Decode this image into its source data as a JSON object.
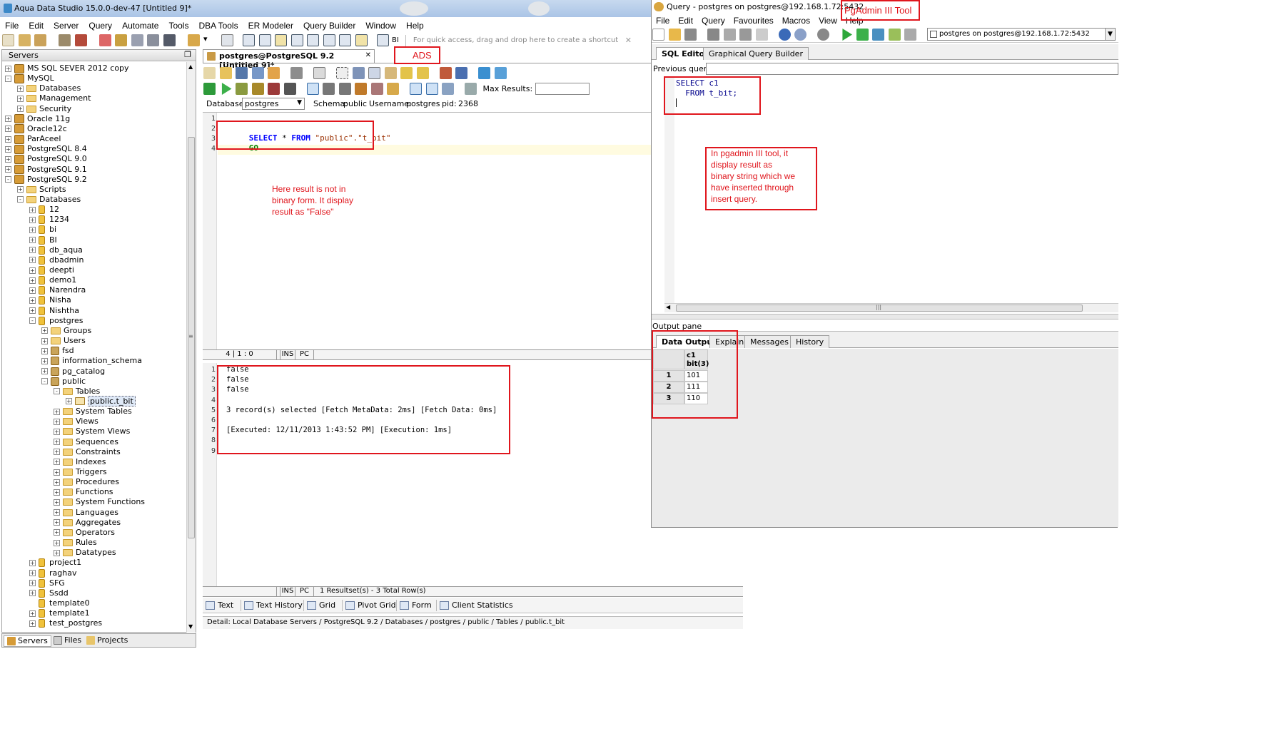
{
  "ads": {
    "title": "Aqua Data Studio 15.0.0-dev-47 [Untitled 9]*",
    "menu": [
      "File",
      "Edit",
      "Server",
      "Query",
      "Automate",
      "Tools",
      "DBA Tools",
      "ER Modeler",
      "Query Builder",
      "Window",
      "Help"
    ],
    "toolbar_hint": "For quick access, drag and drop here to create a shortcut",
    "toolbar_bi": "BI",
    "servers_title": "Servers",
    "tree": [
      {
        "d": 1,
        "e": "+",
        "i": "server",
        "t": "MS SQL SEVER 2012 copy"
      },
      {
        "d": 1,
        "e": "-",
        "i": "server",
        "t": "MySQL"
      },
      {
        "d": 2,
        "e": "+",
        "i": "folder",
        "t": "Databases"
      },
      {
        "d": 2,
        "e": "+",
        "i": "folder",
        "t": "Management"
      },
      {
        "d": 2,
        "e": "+",
        "i": "folder",
        "t": "Security"
      },
      {
        "d": 1,
        "e": "+",
        "i": "server",
        "t": "Oracle 11g"
      },
      {
        "d": 1,
        "e": "+",
        "i": "server",
        "t": "Oracle12c"
      },
      {
        "d": 1,
        "e": "+",
        "i": "server",
        "t": "ParAceel"
      },
      {
        "d": 1,
        "e": "+",
        "i": "server",
        "t": "PostgreSQL 8.4"
      },
      {
        "d": 1,
        "e": "+",
        "i": "server",
        "t": "PostgreSQL 9.0"
      },
      {
        "d": 1,
        "e": "+",
        "i": "server",
        "t": "PostgreSQL 9.1"
      },
      {
        "d": 1,
        "e": "-",
        "i": "server",
        "t": "PostgreSQL 9.2"
      },
      {
        "d": 2,
        "e": "+",
        "i": "folder",
        "t": "Scripts"
      },
      {
        "d": 2,
        "e": "-",
        "i": "folder",
        "t": "Databases"
      },
      {
        "d": 3,
        "e": "+",
        "i": "db",
        "t": "12"
      },
      {
        "d": 3,
        "e": "+",
        "i": "db",
        "t": "1234"
      },
      {
        "d": 3,
        "e": "+",
        "i": "db",
        "t": "bi"
      },
      {
        "d": 3,
        "e": "+",
        "i": "db",
        "t": "BI"
      },
      {
        "d": 3,
        "e": "+",
        "i": "db",
        "t": "db_aqua"
      },
      {
        "d": 3,
        "e": "+",
        "i": "db",
        "t": "dbadmin"
      },
      {
        "d": 3,
        "e": "+",
        "i": "db",
        "t": "deepti"
      },
      {
        "d": 3,
        "e": "+",
        "i": "db",
        "t": "demo1"
      },
      {
        "d": 3,
        "e": "+",
        "i": "db",
        "t": "Narendra"
      },
      {
        "d": 3,
        "e": "+",
        "i": "db",
        "t": "Nisha"
      },
      {
        "d": 3,
        "e": "+",
        "i": "db",
        "t": "Nishtha"
      },
      {
        "d": 3,
        "e": "-",
        "i": "db",
        "t": "postgres"
      },
      {
        "d": 4,
        "e": "+",
        "i": "folder",
        "t": "Groups"
      },
      {
        "d": 4,
        "e": "+",
        "i": "folder",
        "t": "Users"
      },
      {
        "d": 4,
        "e": "+",
        "i": "schema",
        "t": "fsd"
      },
      {
        "d": 4,
        "e": "+",
        "i": "schema",
        "t": "information_schema"
      },
      {
        "d": 4,
        "e": "+",
        "i": "schema",
        "t": "pg_catalog"
      },
      {
        "d": 4,
        "e": "-",
        "i": "schema",
        "t": "public"
      },
      {
        "d": 5,
        "e": "-",
        "i": "folder",
        "t": "Tables"
      },
      {
        "d": 6,
        "e": "+",
        "i": "table",
        "t": "public.t_bit",
        "sel": true
      },
      {
        "d": 5,
        "e": "+",
        "i": "folder",
        "t": "System Tables"
      },
      {
        "d": 5,
        "e": "+",
        "i": "folder",
        "t": "Views"
      },
      {
        "d": 5,
        "e": "+",
        "i": "folder",
        "t": "System Views"
      },
      {
        "d": 5,
        "e": "+",
        "i": "folder",
        "t": "Sequences"
      },
      {
        "d": 5,
        "e": "+",
        "i": "folder",
        "t": "Constraints"
      },
      {
        "d": 5,
        "e": "+",
        "i": "folder",
        "t": "Indexes"
      },
      {
        "d": 5,
        "e": "+",
        "i": "folder",
        "t": "Triggers"
      },
      {
        "d": 5,
        "e": "+",
        "i": "folder",
        "t": "Procedures"
      },
      {
        "d": 5,
        "e": "+",
        "i": "folder",
        "t": "Functions"
      },
      {
        "d": 5,
        "e": "+",
        "i": "folder",
        "t": "System Functions"
      },
      {
        "d": 5,
        "e": "+",
        "i": "folder",
        "t": "Languages"
      },
      {
        "d": 5,
        "e": "+",
        "i": "folder",
        "t": "Aggregates"
      },
      {
        "d": 5,
        "e": "+",
        "i": "folder",
        "t": "Operators"
      },
      {
        "d": 5,
        "e": "+",
        "i": "folder",
        "t": "Rules"
      },
      {
        "d": 5,
        "e": "+",
        "i": "folder",
        "t": "Datatypes"
      },
      {
        "d": 3,
        "e": "+",
        "i": "db",
        "t": "project1"
      },
      {
        "d": 3,
        "e": "+",
        "i": "db",
        "t": "raghav"
      },
      {
        "d": 3,
        "e": "+",
        "i": "db",
        "t": "SFG"
      },
      {
        "d": 3,
        "e": "+",
        "i": "db",
        "t": "Ssdd"
      },
      {
        "d": 3,
        "e": "",
        "i": "db",
        "t": "template0"
      },
      {
        "d": 3,
        "e": "+",
        "i": "db",
        "t": "template1"
      },
      {
        "d": 3,
        "e": "+",
        "i": "db",
        "t": "test_postgres"
      }
    ],
    "bottom_tabs": [
      "Servers",
      "Files",
      "Projects"
    ],
    "editor_tab": "postgres@PostgreSQL 9.2 [Untitled 9]*",
    "max_results_label": "Max Results:",
    "database_label": "Database:",
    "database_value": "postgres",
    "schema_label": "Schema:",
    "schema_value": "public",
    "username_label": "Username:",
    "username_value": "postgres",
    "pid_label": "pid:",
    "pid_value": "2368",
    "code_lines": [
      "1",
      "2",
      "3",
      "4"
    ],
    "code_kw1": "SELECT",
    "code_mid": " * ",
    "code_kw2": "FROM",
    "code_str": " \"public\".\"t_bit\"",
    "code_go": "GO",
    "editor_status": [
      "4 | 1 : 0",
      "INS",
      "PC"
    ],
    "result_lines": [
      "1",
      "2",
      "3",
      "4",
      "5",
      "6",
      "7",
      "8",
      "9"
    ],
    "result_text": [
      "false",
      "false",
      "false",
      "",
      "3 record(s) selected [Fetch MetaData: 2ms] [Fetch Data: 0ms]",
      "",
      "[Executed: 12/11/2013 1:43:52 PM] [Execution: 1ms]",
      "",
      ""
    ],
    "result_status": [
      "INS",
      "PC",
      "1 Resultset(s) - 3 Total Row(s)"
    ],
    "result_tabs": [
      "Text",
      "Text History",
      "Grid",
      "Pivot Grid",
      "Form",
      "Client Statistics"
    ],
    "detail": "Detail: Local Database Servers / PostgreSQL 9.2 / Databases / postgres / public / Tables / public.t_bit"
  },
  "pgadmin": {
    "title": "Query - postgres on postgres@192.168.1.72:5432",
    "menu": [
      "File",
      "Edit",
      "Query",
      "Favourites",
      "Macros",
      "View",
      "Help"
    ],
    "connection": "postgres on postgres@192.168.1.72:5432",
    "tabs": [
      "SQL Editor",
      "Graphical Query Builder"
    ],
    "previous_queries": "Previous queries",
    "sql_line1": "SELECT c1",
    "sql_line2": "  FROM t_bit;",
    "output_pane": "Output pane",
    "output_tabs": [
      "Data Output",
      "Explain",
      "Messages",
      "History"
    ],
    "col_name": "c1",
    "col_type": "bit(3)",
    "rows": [
      {
        "n": "1",
        "v": "101"
      },
      {
        "n": "2",
        "v": "111"
      },
      {
        "n": "3",
        "v": "110"
      }
    ]
  },
  "annotations": {
    "ads_label": "ADS",
    "pgadmin_label": "PgAdmin III Tool",
    "ads_note": [
      "Here result is not in",
      "binary form. It display",
      "result as \"False\""
    ],
    "pg_note": [
      "In pgadmin III tool, it",
      "display result as",
      "binary string which we",
      "have inserted through",
      "insert query."
    ]
  },
  "colors": {
    "accent_red": "#e0161d",
    "keyword_blue": "#0000ff",
    "string_brown": "#9a2f00",
    "go_green": "#008000"
  }
}
